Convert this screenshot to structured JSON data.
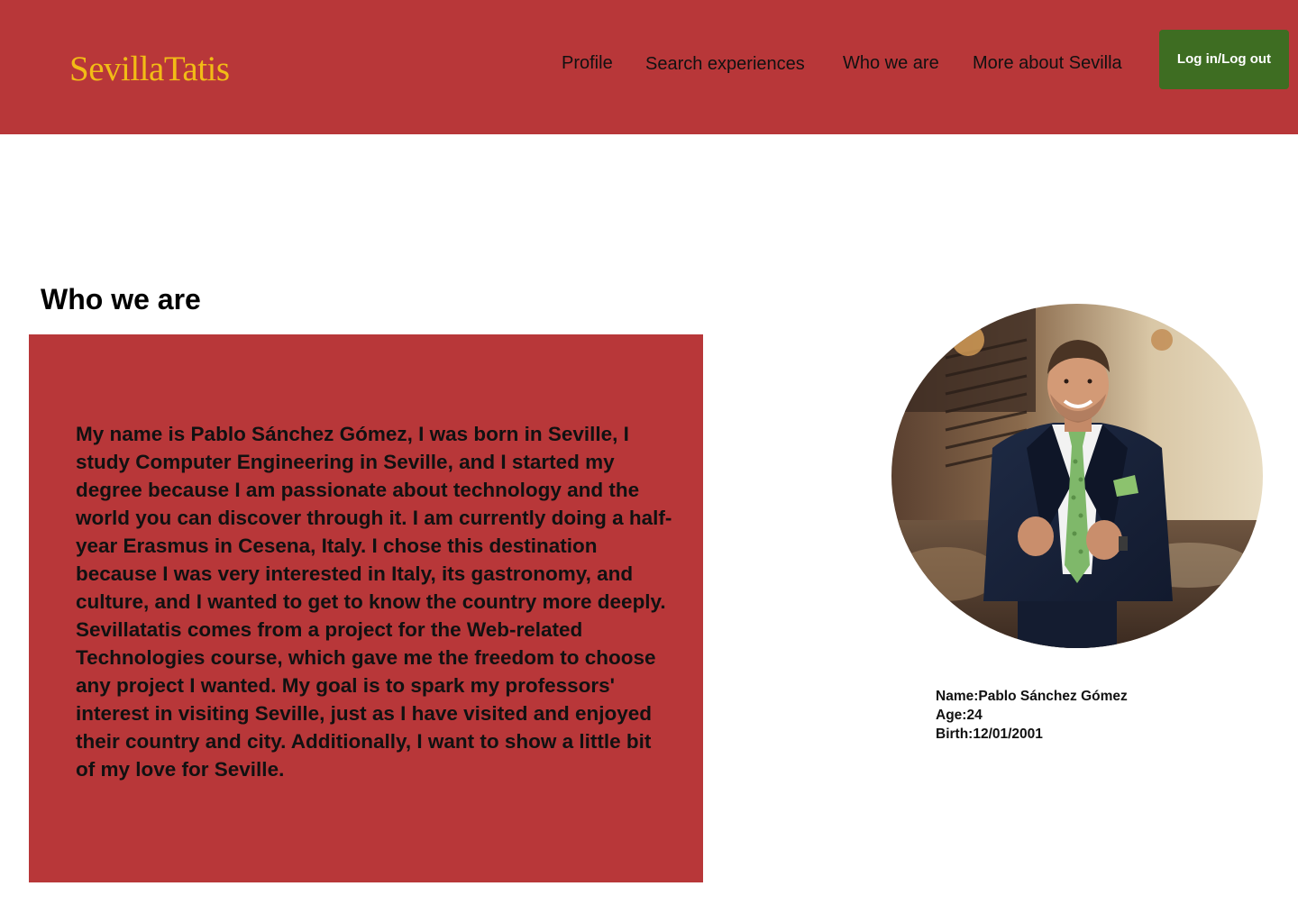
{
  "header": {
    "logo": "SevillaTatis",
    "nav": {
      "profile": "Profile",
      "search": "Search experiences",
      "who": "Who we are",
      "more": "More about Sevilla"
    },
    "login_button": "Log in/Log out"
  },
  "main": {
    "title": "Who we are",
    "bio": {
      "paragraph1": "My name is Pablo Sánchez Gómez, I was born in Seville, I study Computer Engineering in Seville, and I started my degree because I am passionate about technology and the world you can discover through it. I am currently doing a half-year Erasmus in Cesena, Italy. I chose this destination because I was very interested in Italy, its gastronomy, and culture, and I wanted to get to know the country more deeply.",
      "paragraph2": "Sevillatatis comes from a project for the Web-related Technologies course, which gave me the freedom to choose any project I wanted. My goal is to spark my professors' interest in visiting Seville, just as I have visited and enjoyed their country and city. Additionally, I want to show a little bit of my love for Seville."
    },
    "profile": {
      "name_line": "Name:Pablo Sánchez Gómez",
      "age_line": "Age:24",
      "birth_line": "Birth:12/01/2001"
    }
  },
  "colors": {
    "header_bg": "#b83739",
    "logo": "#f2bc16",
    "login_button_bg": "#3e6d22",
    "bio_box_bg": "#b83739"
  }
}
